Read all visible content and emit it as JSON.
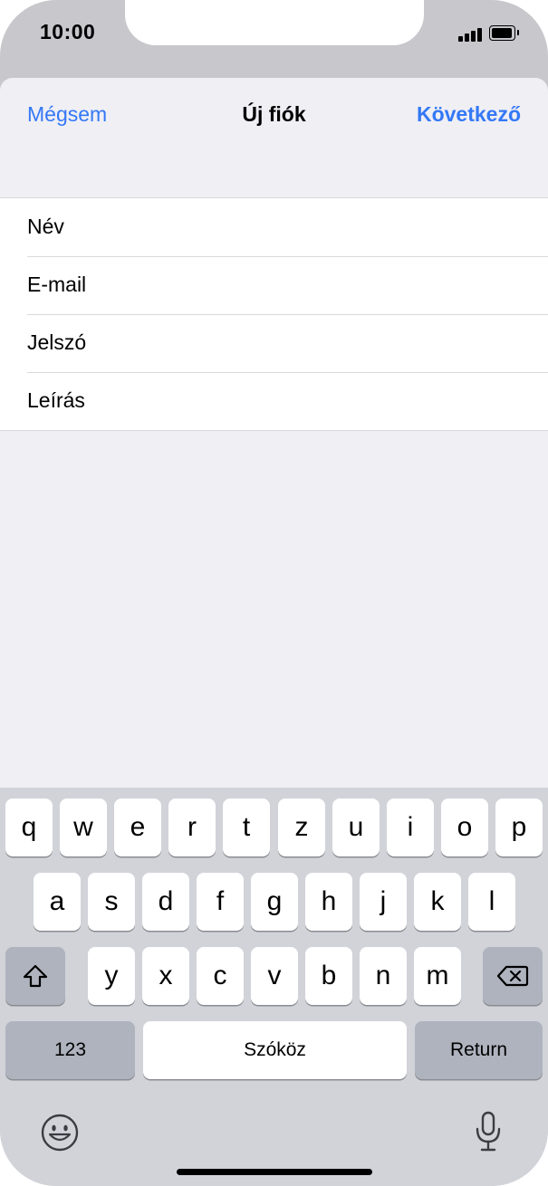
{
  "status": {
    "time": "10:00"
  },
  "nav": {
    "cancel": "Mégsem",
    "title": "Új fiók",
    "next": "Következő"
  },
  "form": {
    "fields": [
      {
        "label": "Név",
        "value": ""
      },
      {
        "label": "E-mail",
        "value": ""
      },
      {
        "label": "Jelszó",
        "value": ""
      },
      {
        "label": "Leírás",
        "value": ""
      }
    ]
  },
  "keyboard": {
    "row1": [
      "q",
      "w",
      "e",
      "r",
      "t",
      "z",
      "u",
      "i",
      "o",
      "p"
    ],
    "row2": [
      "a",
      "s",
      "d",
      "f",
      "g",
      "h",
      "j",
      "k",
      "l"
    ],
    "row3": [
      "y",
      "x",
      "c",
      "v",
      "b",
      "n",
      "m"
    ],
    "numbers_key": "123",
    "space_key": "Szóköz",
    "return_key": "Return",
    "shift_icon": "shift-icon",
    "delete_icon": "delete-icon",
    "emoji_icon": "emoji-icon",
    "mic_icon": "microphone-icon"
  },
  "colors": {
    "accent": "#3478f6",
    "sheet_bg": "#efeff4",
    "keyboard_bg": "#d1d3d9",
    "function_key": "#aeb3be"
  }
}
